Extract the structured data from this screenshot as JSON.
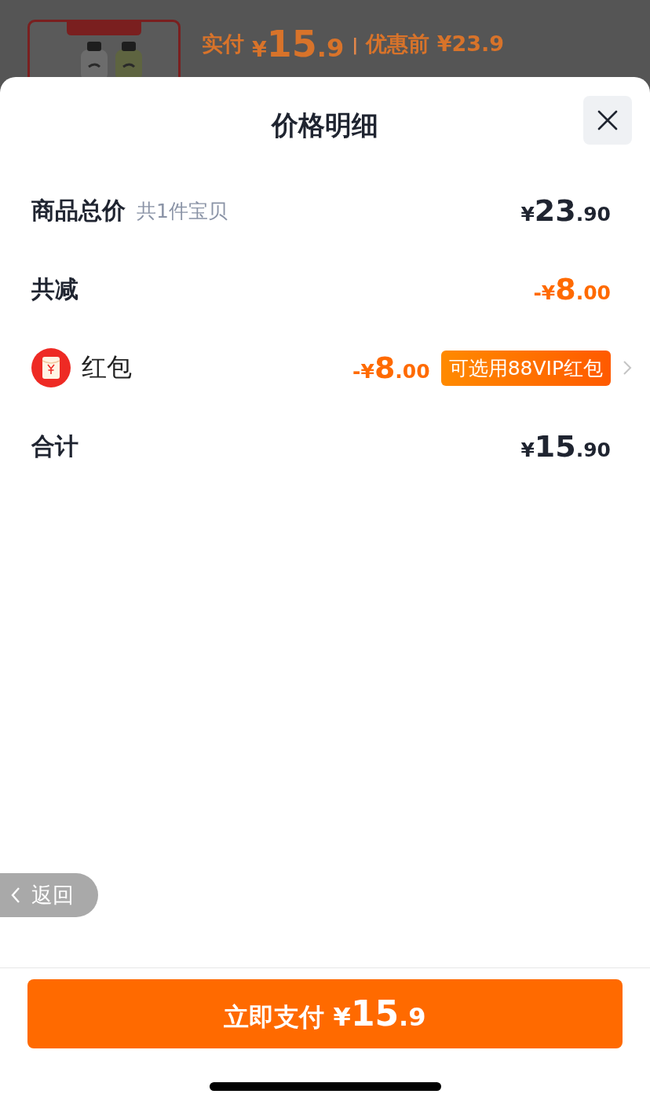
{
  "background_product": {
    "paid_label": "实付",
    "paid_price": {
      "currency": "¥",
      "integer": "15",
      "decimal": ".9"
    },
    "separator": "|",
    "original_label": "优惠前",
    "original_price": "¥23.9"
  },
  "sheet": {
    "title": "价格明细"
  },
  "rows": [
    {
      "kind": "total",
      "label": "商品总价",
      "note": "共1件宝贝",
      "price": {
        "currency": "¥",
        "integer": "23",
        "decimal": ".90"
      }
    },
    {
      "kind": "discount",
      "label": "共减",
      "price": {
        "currency": "-¥",
        "integer": "8",
        "decimal": ".00"
      }
    },
    {
      "kind": "coupon",
      "label": "红包",
      "price": {
        "currency": "-¥",
        "integer": "8",
        "decimal": ".00"
      },
      "badge": "可选用88VIP红包"
    },
    {
      "kind": "total",
      "label": "合计",
      "price": {
        "currency": "¥",
        "integer": "15",
        "decimal": ".90"
      }
    }
  ],
  "back_button": {
    "label": "返回"
  },
  "pay_button": {
    "label": "立即支付",
    "price": {
      "currency": "¥",
      "integer": "15",
      "decimal": ".9"
    }
  }
}
